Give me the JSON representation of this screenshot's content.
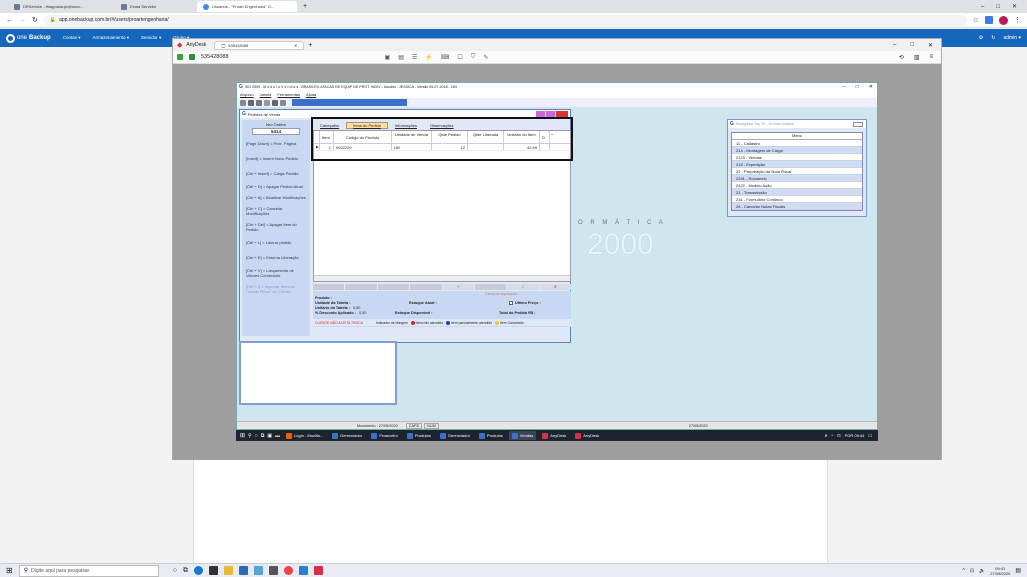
{
  "browser": {
    "tabs": [
      {
        "label": "DRService - thiagoaraujo@onec...",
        "active": false
      },
      {
        "label": "Exata Servidor",
        "active": false
      },
      {
        "label": "Usuários - \"Proart Engenharia\" O...",
        "active": true
      }
    ],
    "new_tab": "+",
    "url": "app.onebackup.com.br/#/users/proartengenharia/",
    "window_controls": [
      "–",
      "□",
      "✕"
    ]
  },
  "onebackup": {
    "logo_one": "one",
    "logo_backup": "Backup",
    "menu": [
      "Contas ▾",
      "Armazenamento ▾",
      "Servidor ▾",
      "Grupo ▾"
    ],
    "user": "admin ▾"
  },
  "anydesk": {
    "title": "AnyDesk",
    "session_tab": "535428088",
    "address": "535428088",
    "new_tab": "+"
  },
  "remote": {
    "title": "SIG 2000 - M ó d u l o  V e n d a s - BRASILEG ATACAD DE EQUIP DE PROT. INDIV - Usuário : JESSICA - Versão 05-07-2018 - 164",
    "menus": [
      "Arquivo",
      "Janela",
      "Ferramentas",
      "Ajuda"
    ],
    "pedido_title": "Pedidos de Venda",
    "nro_ordem_label": "Nro Ordem",
    "nro_ordem_value": "5414",
    "shortcuts": [
      "[Page Down] = Próx. Página",
      "[Insert] = Inserir Novo Pedido",
      "[Ctrl + Insert] = Carga Padrão",
      "[Ctrl + D] = Apagar Pedido Atual",
      "[Ctrl + A] = Atualizar Modificações",
      "[Ctrl + C] = Cancelar Modificações",
      "[Ctrl + Del] = Apagar Item do Pedido",
      "[Ctrl + L] = Liberar pedido",
      "[Ctrl + E] = Estorna Liberação",
      "[Ctrl + V] = Lançamento de Valores Comerciais",
      "[Ctrl + I] = Importar Itens de \"Venda Placa\" do Cliente"
    ],
    "tabs": [
      "Cabeçalho",
      "Itens do Pedido",
      "Informações",
      "Observações"
    ],
    "columns": [
      "Item",
      "Código do Produto",
      "Unidade de Venda",
      "Qtde Pedido",
      "Qtde Liberada",
      "Unitário do Item",
      "D"
    ],
    "rows": [
      {
        "item": "1",
        "codigo": "0022229",
        "unidade": "UN",
        "qtde_pedido": "12",
        "qtde_liberada": "",
        "unitario": "42,99"
      }
    ],
    "faixa_label": "Faixa de Aquisição :",
    "produto_label": "Produto :",
    "unidade_tabela_label": "Unidade da Tabela :",
    "unitario_tabela_label": "Unitário da Tabela :",
    "unitario_tabela_value": "0,00",
    "desconto_label": "% Desconto Aplicado :",
    "desconto_value": "0,00",
    "estoque_atual_label": "Estoque Atual :",
    "estoque_disp_label": "Estoque Disponível :",
    "ultimo_preco_label": "Último Preço :",
    "total_label": "Total do Pedido R$ :",
    "legend": [
      "CLIENTE NÃO ACEITA TROCA",
      "Indicador de Margem",
      "Item não atendido",
      "Item parcialmente atendido",
      "Item Cancelado"
    ],
    "logo_word": "O R M Á T I C A",
    "logo_year": "2000",
    "nav_title": "Navegador Top 10 - 10 mais usados",
    "nav_header": "Menu",
    "nav_items": [
      "11 - Cadastro",
      "214 - Montagem de Carga",
      "2123 - Vendas",
      "215 - Expedição",
      "22 - Preparação da Nota Fiscal",
      "2291 - Romaneio",
      "2422 - Modelo Ação",
      "21 - Transmissão",
      "231 - Formulário Contínuo",
      "26 - Cancelar Notas Fiscais"
    ],
    "status": [
      "Movimento : 27/05/2020",
      "CAPS",
      "NUM",
      "27/05/2020"
    ],
    "taskbar": [
      "Login - Mozilla...",
      "Gerenciador",
      "Financeiro",
      "Produtos",
      "Gerenciador",
      "Produtos",
      "Vendas",
      "AnyDesk",
      "AnyDesk"
    ],
    "tray": "POR  09:44"
  },
  "host_taskbar": {
    "search": "Digite aqui para pesquisar",
    "time": "09:41",
    "date": "27/05/2020"
  },
  "colors": {
    "win_blue": "#1f5fbf",
    "anydesk_red": "#d9304a",
    "remote_teal": "#cfe6ee",
    "highlight": "#ffdf9a"
  }
}
